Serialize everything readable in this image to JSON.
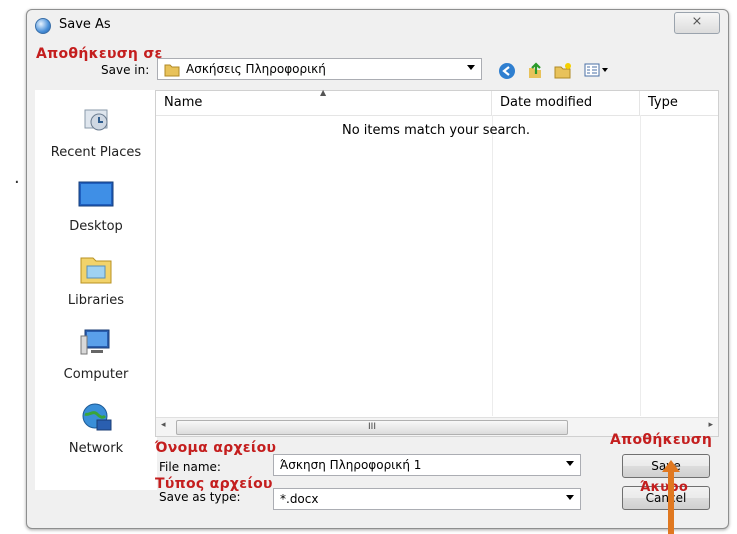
{
  "window": {
    "title": "Save As",
    "close_glyph": "⨯"
  },
  "save_in": {
    "label": "Save in:",
    "value": "Ασκήσεις Πληροφορική"
  },
  "toolbar": {
    "back_icon": "back-icon",
    "up_icon": "up-folder-icon",
    "new_folder_icon": "new-folder-icon",
    "views_icon": "views-menu-icon"
  },
  "places": [
    {
      "label": "Recent Places",
      "icon": "recent-places-icon"
    },
    {
      "label": "Desktop",
      "icon": "desktop-icon"
    },
    {
      "label": "Libraries",
      "icon": "libraries-icon"
    },
    {
      "label": "Computer",
      "icon": "computer-icon"
    },
    {
      "label": "Network",
      "icon": "network-icon"
    }
  ],
  "list": {
    "columns": [
      "Name",
      "Date modified",
      "Type"
    ],
    "empty_message": "No items match your search.",
    "scroll_grip": "III"
  },
  "file_name": {
    "label": "File name:",
    "value": "Άσκηση Πληροφορική 1"
  },
  "save_type": {
    "label": "Save as type:",
    "value": "*.docx"
  },
  "buttons": {
    "save": "Save",
    "cancel": "Cancel"
  },
  "annotations": {
    "save_in": "Αποθήκευση σε",
    "file_name": "Όνομα αρχείου",
    "file_type": "Τύπος αρχείου",
    "save": "Αποθήκευση",
    "cancel": "Άκυρο"
  },
  "colors": {
    "annotation": "#c41e1e",
    "arrow": "#e07820"
  }
}
